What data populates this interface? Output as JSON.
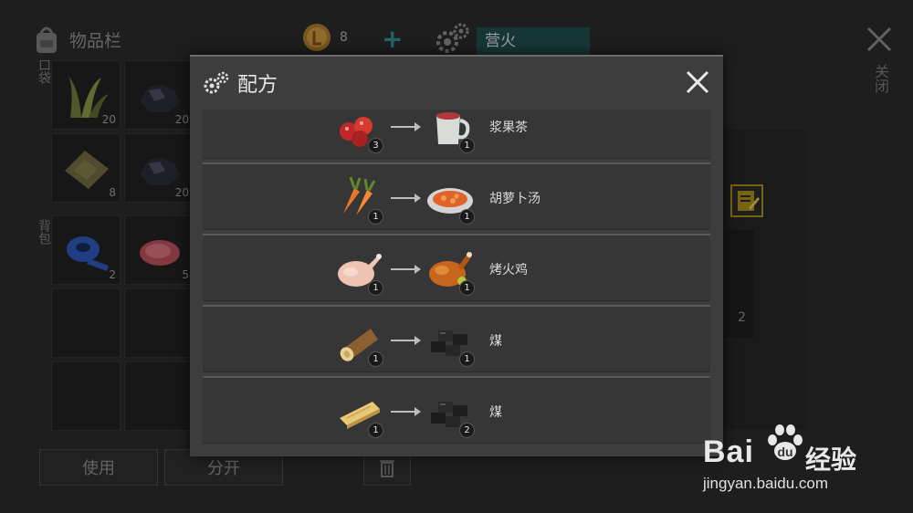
{
  "inventory": {
    "title": "物品栏",
    "pocket_label": "口袋",
    "backpack_label": "背包",
    "slots": [
      {
        "item": "grass",
        "count": "20"
      },
      {
        "item": "coal-ore",
        "count": "20"
      },
      {
        "item": "cloth",
        "count": "8"
      },
      {
        "item": "coal-ore",
        "count": "20"
      },
      {
        "item": "duct-tape",
        "count": "2"
      },
      {
        "item": "raw-meat",
        "count": "5"
      }
    ],
    "use_button": "使用",
    "split_button": "分开"
  },
  "currency": {
    "count": "8"
  },
  "station": {
    "name": "营火"
  },
  "close_label": "关闭",
  "right_panel": {
    "slot_count": "2"
  },
  "modal": {
    "title": "配方",
    "recipes": [
      {
        "input_icon": "berries-icon",
        "input_count": "3",
        "output_icon": "tea-mug-icon",
        "output_count": "1",
        "name": "浆果茶"
      },
      {
        "input_icon": "carrot-icon",
        "input_count": "1",
        "output_icon": "carrot-soup-icon",
        "output_count": "1",
        "name": "胡萝卜汤"
      },
      {
        "input_icon": "raw-chicken-icon",
        "input_count": "1",
        "output_icon": "roast-chicken-icon",
        "output_count": "1",
        "name": "烤火鸡"
      },
      {
        "input_icon": "log-icon",
        "input_count": "1",
        "output_icon": "coal-icon",
        "output_count": "1",
        "name": "煤"
      },
      {
        "input_icon": "plank-icon",
        "input_count": "1",
        "output_icon": "coal-icon",
        "output_count": "2",
        "name": "煤"
      }
    ]
  },
  "watermark": {
    "brand": "Bai",
    "brand_cn": "经验",
    "url": "jingyan.baidu.com"
  }
}
